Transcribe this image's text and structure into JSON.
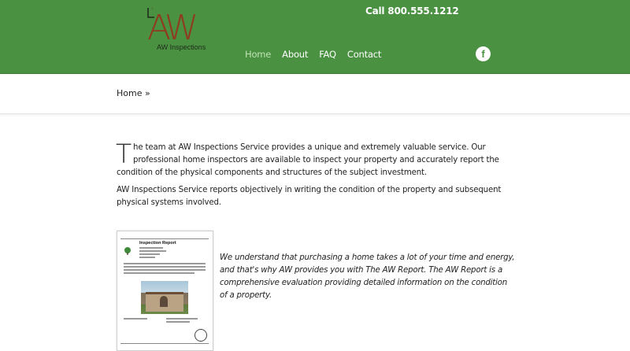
{
  "header": {
    "logo": {
      "letters": "AW",
      "subtitle": "AW Inspections"
    },
    "call": "Call 800.555.1212",
    "nav": [
      {
        "label": "Home",
        "active": true
      },
      {
        "label": "About",
        "active": false
      },
      {
        "label": "FAQ",
        "active": false
      },
      {
        "label": "Contact",
        "active": false
      }
    ],
    "social": {
      "icon": "facebook-icon",
      "glyph": "f"
    },
    "colors": {
      "header_bg": "#4a9142",
      "nav_active": "#bfe3b5"
    }
  },
  "breadcrumb": {
    "text": "Home »"
  },
  "intro": {
    "dropcap": "T",
    "paragraph1_rest": "he team at AW Inspections Service provides a unique and extremely valuable service. Our professional home inspectors are available to inspect your property and accurately report the condition of the physical components and structures of the subject investment.",
    "paragraph2": "AW Inspections Service reports objectively in writing the condition of the property and subsequent physical systems involved."
  },
  "report_thumbnail": {
    "title": "Inspection Report"
  },
  "quote": "We understand that purchasing a home takes a lot of your time and energy, and that's why AW provides you with The AW Report. The AW Report is a comprehensive evaluation providing detailed information on the condition of a property."
}
